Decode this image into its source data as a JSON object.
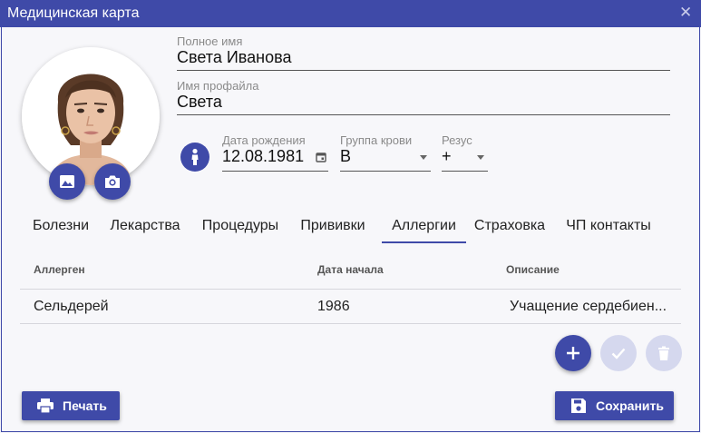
{
  "window": {
    "title": "Медицинская карта"
  },
  "profile": {
    "full_name_label": "Полное имя",
    "full_name": "Света Иванова",
    "profile_name_label": "Имя профайла",
    "profile_name": "Света",
    "birth_date_label": "Дата рождения",
    "birth_date": "12.08.1981",
    "blood_group_label": "Группа крови",
    "blood_group": "B",
    "rhesus_label": "Резус",
    "rhesus": "+"
  },
  "tabs": [
    {
      "label": "Болезни",
      "active": false
    },
    {
      "label": "Лекарства",
      "active": false
    },
    {
      "label": "Процедуры",
      "active": false
    },
    {
      "label": "Прививки",
      "active": false
    },
    {
      "label": "Аллергии",
      "active": true
    },
    {
      "label": "Страховка",
      "active": false
    },
    {
      "label": "ЧП контакты",
      "active": false
    }
  ],
  "table": {
    "columns": [
      "Аллерген",
      "Дата начала",
      "Описание"
    ],
    "rows": [
      [
        "Сельдерей",
        "1986",
        "Учащение сердебиен..."
      ]
    ]
  },
  "buttons": {
    "print": "Печать",
    "save": "Сохранить"
  },
  "colors": {
    "accent": "#3f4aa8",
    "disabled": "#d5d8ee"
  },
  "icons": {
    "gallery": "image-icon",
    "camera": "camera-icon",
    "person": "person-icon",
    "add": "plus-icon",
    "confirm": "check-icon",
    "delete": "trash-icon",
    "print": "printer-icon",
    "save": "floppy-icon"
  }
}
